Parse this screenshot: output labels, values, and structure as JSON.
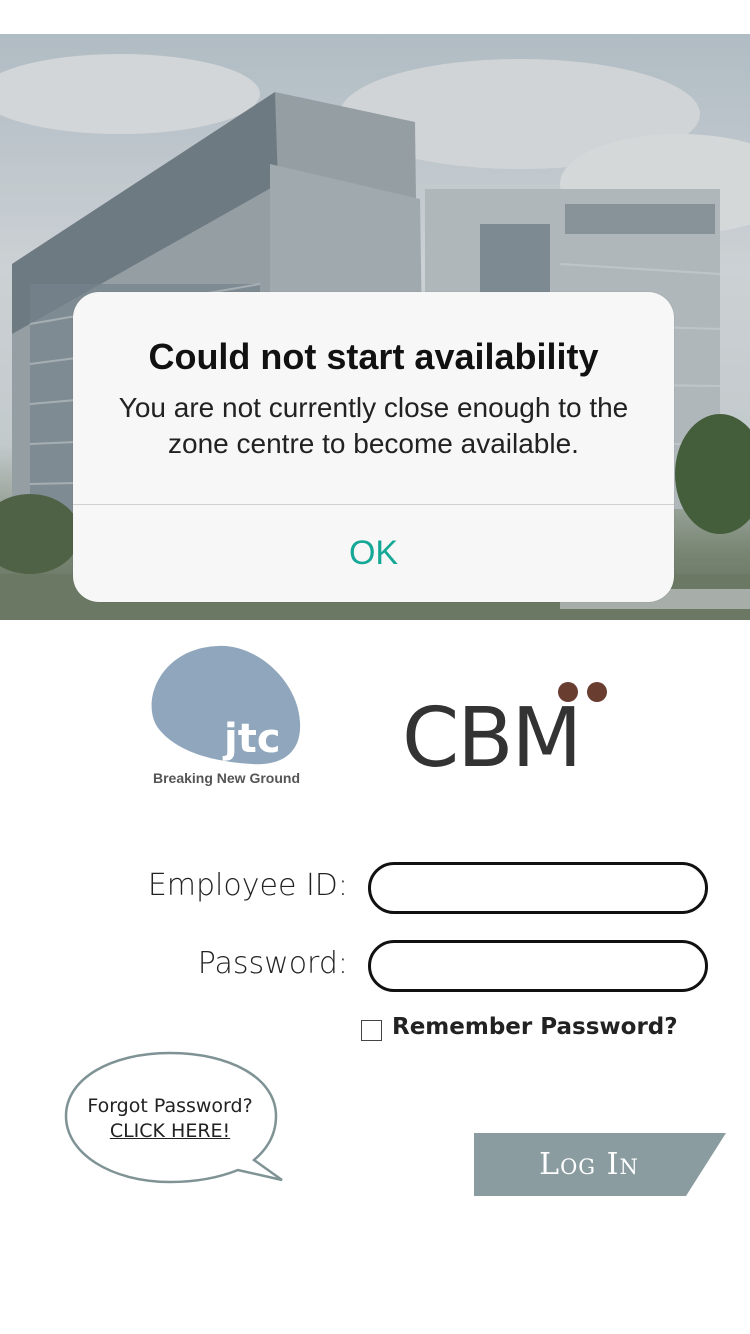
{
  "alert": {
    "title": "Could not start availability",
    "message": "You are not currently close enough to the zone centre to become available.",
    "ok_label": "OK"
  },
  "logos": {
    "jtc_text": "jtc",
    "jtc_tagline": "Breaking New Ground",
    "cbm_text": "CBM"
  },
  "form": {
    "employee_id_label": "Employee ID:",
    "employee_id_value": "",
    "password_label": "Password:",
    "password_value": "",
    "remember_label": "Remember Password?",
    "remember_checked": false
  },
  "forgot": {
    "line1": "Forgot Password?",
    "link": "CLICK HERE!"
  },
  "login": {
    "label": "Log In"
  },
  "colors": {
    "accent": "#16a897",
    "login_button": "#8a9ca0",
    "jtc_blob": "#8fa6bc",
    "cbm_dots": "#6a3d31"
  }
}
